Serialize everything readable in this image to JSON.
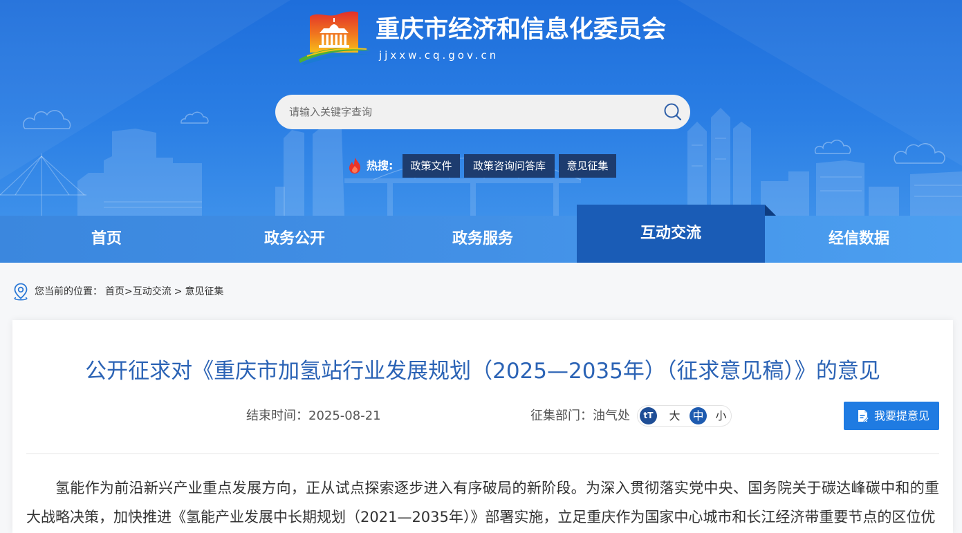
{
  "colors": {
    "header_top": "#1e6edb",
    "header_bottom": "#3d90ea",
    "nav_bg": "#4290e6",
    "nav_active": "#1a5cb6",
    "title_blue": "#2b63b5",
    "button_blue": "#1f7be2",
    "hot_tag_bg": "#1d3c6f"
  },
  "site": {
    "title": "重庆市经济和信息化委员会",
    "domain": "jjxxw.cq.gov.cn",
    "logo_icon": "chongqing-emblem-logo"
  },
  "search": {
    "placeholder": "请输入关键字查询",
    "value": "",
    "icon": "search-icon"
  },
  "hot_search": {
    "icon": "flame-icon",
    "label": "热搜:",
    "tags": [
      "政策文件",
      "政策咨询问答库",
      "意见征集"
    ]
  },
  "nav": {
    "items": [
      {
        "label": "首页",
        "active": false
      },
      {
        "label": "政务公开",
        "active": false
      },
      {
        "label": "政务服务",
        "active": false
      },
      {
        "label": "互动交流",
        "active": true
      },
      {
        "label": "经信数据",
        "active": false
      }
    ]
  },
  "breadcrumb": {
    "icon": "location-pin-icon",
    "label": "您当前的位置：",
    "items": [
      "首页",
      "互动交流",
      "意见征集"
    ],
    "separator": ">"
  },
  "article": {
    "title": "公开征求对《重庆市加氢站行业发展规划（2025—2035年）（征求意见稿）》的意见",
    "end_time_label": "结束时间：",
    "end_time": "2025-08-21",
    "department_label": "征集部门：",
    "department": "油气处",
    "font_size": {
      "icon_glyph": "tT",
      "options": [
        "大",
        "中",
        "小"
      ],
      "selected": "中"
    },
    "feedback_button": {
      "label": "我要提意见",
      "icon": "document-edit-icon"
    },
    "body": [
      "氢能作为前沿新兴产业重点发展方向，正从试点探索逐步进入有序破局的新阶段。为深入贯彻落实党中央、国务院关于碳达峰碳中和的重大战略决策，加快推进《氢能产业发展中长期规划（2021—2035年）》部署实施，立足重庆作为国家中心城市和长江经济带重要节点的区位优"
    ]
  }
}
